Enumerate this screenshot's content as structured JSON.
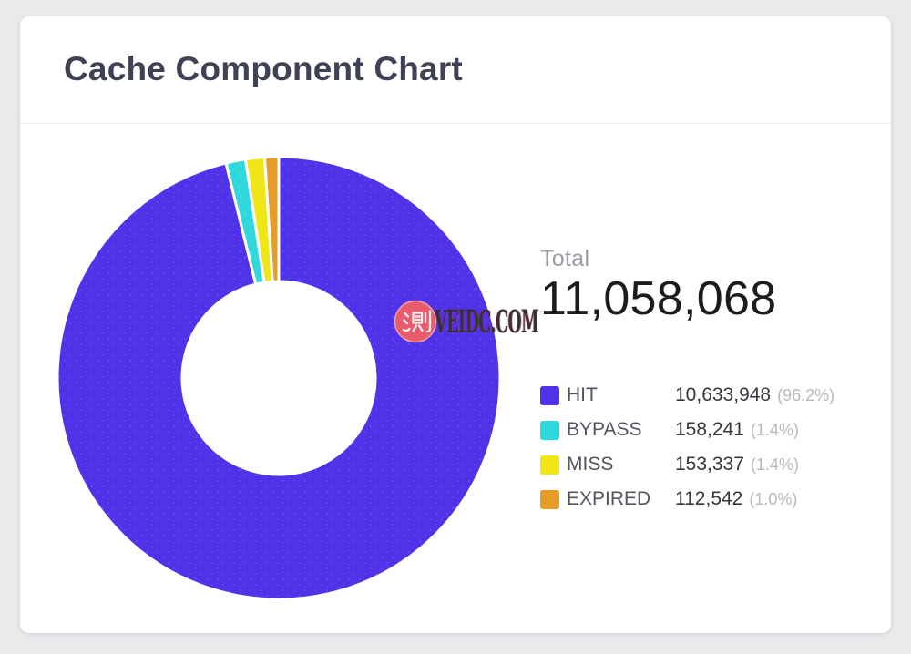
{
  "window": {
    "background_color": "#EAEAED"
  },
  "card": {
    "title": "Cache Component Chart"
  },
  "summary": {
    "total_label": "Total",
    "total_value": "11,058,068"
  },
  "watermark": {
    "stamp_char": "测",
    "stamp_color": "#E85C6E",
    "text": "VEIDC.COM"
  },
  "chart_data": {
    "type": "pie",
    "subtype": "donut",
    "title": "Cache Component Chart",
    "total": 11058068,
    "total_display": "11,058,068",
    "start_angle_deg": 0,
    "direction": "clockwise",
    "legend_position": "right",
    "inner_radius_px": 106,
    "outer_radius_px": 243,
    "slice_gap_color": "#FFFFFF",
    "series": [
      {
        "name": "HIT",
        "value": 10633948,
        "display": "10,633,948",
        "pct": "96.2%",
        "pct_display": "(96.2%)",
        "color": "#5033E8"
      },
      {
        "name": "BYPASS",
        "value": 158241,
        "display": "158,241",
        "pct": "1.4%",
        "pct_display": "(1.4%)",
        "color": "#2FD8DD"
      },
      {
        "name": "MISS",
        "value": 153337,
        "display": "153,337",
        "pct": "1.4%",
        "pct_display": "(1.4%)",
        "color": "#F0E515"
      },
      {
        "name": "EXPIRED",
        "value": 112542,
        "display": "112,542",
        "pct": "1.0%",
        "pct_display": "(1.0%)",
        "color": "#E69C27"
      }
    ]
  }
}
